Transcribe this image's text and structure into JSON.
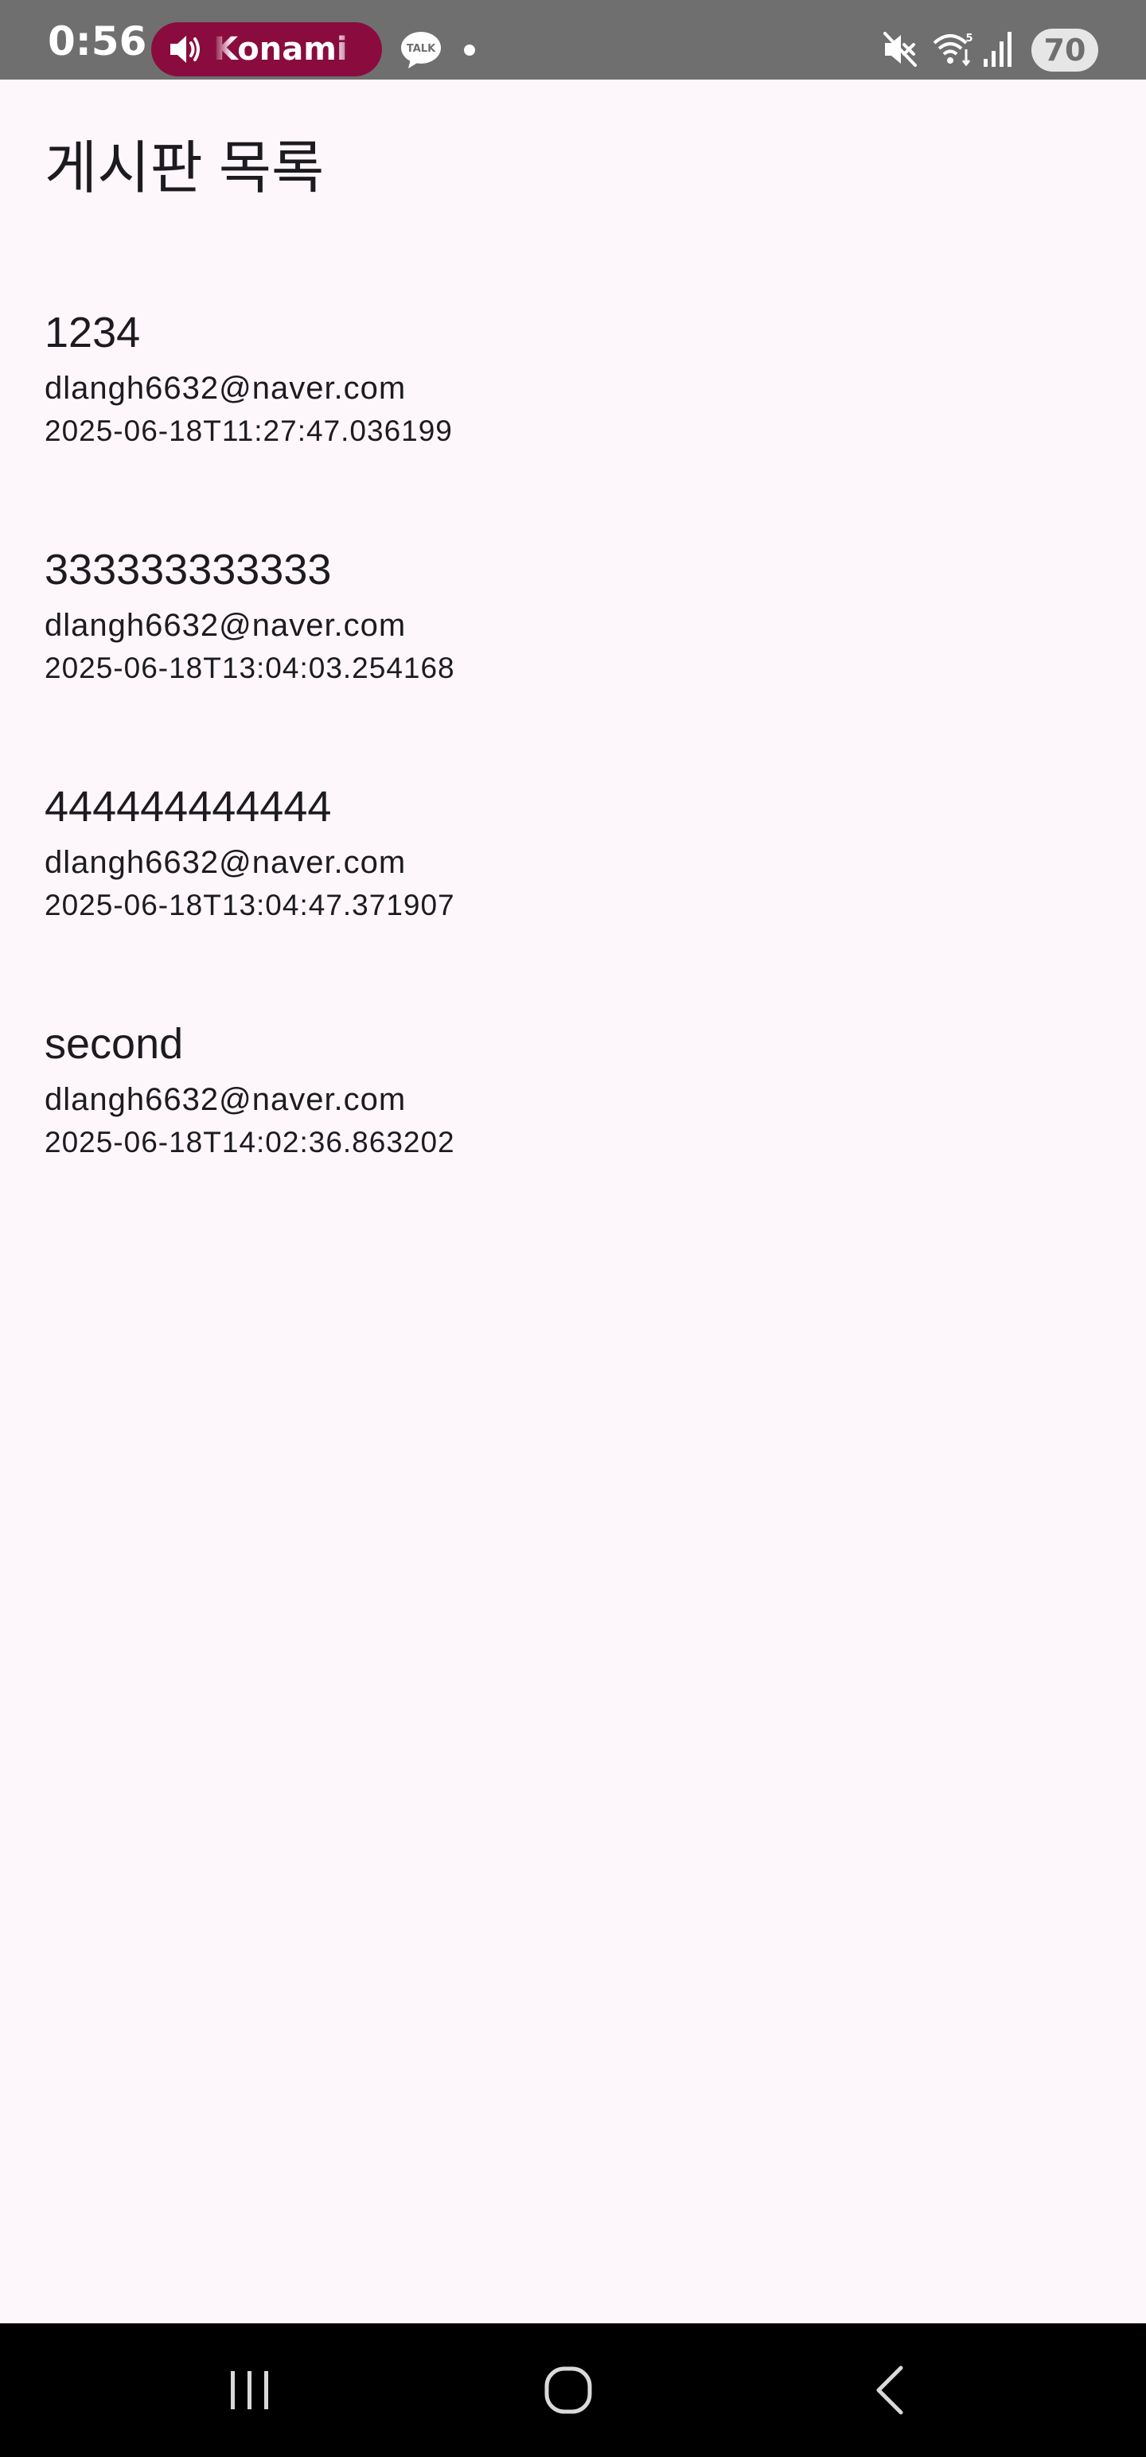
{
  "status_bar": {
    "time": "0:56",
    "media_title": "Konami Sp",
    "battery": "70",
    "colors": {
      "background": "#6f6f6f",
      "media_pill": "#8a0c3e"
    },
    "icons": [
      "volume-icon",
      "talk-icon",
      "notification-dot",
      "mute-icon",
      "wifi-icon",
      "signal-icon",
      "battery-indicator"
    ]
  },
  "page": {
    "title": "게시판 목록",
    "background": "#fdf7fb"
  },
  "posts": [
    {
      "title": "1234",
      "author": "dlangh6632@naver.com",
      "date": "2025-06-18T11:27:47.036199"
    },
    {
      "title": "333333333333",
      "author": "dlangh6632@naver.com",
      "date": "2025-06-18T13:04:03.254168"
    },
    {
      "title": "444444444444",
      "author": "dlangh6632@naver.com",
      "date": "2025-06-18T13:04:47.371907"
    },
    {
      "title": "second",
      "author": "dlangh6632@naver.com",
      "date": "2025-06-18T14:02:36.863202"
    }
  ],
  "nav_bar": {
    "icons": [
      "recent-apps-icon",
      "home-icon",
      "back-icon"
    ]
  }
}
